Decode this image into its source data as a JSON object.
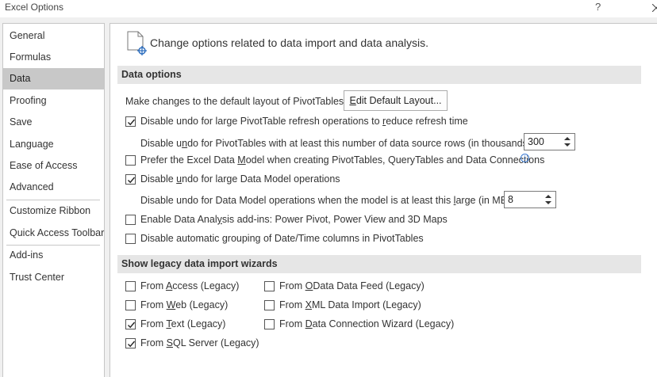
{
  "window": {
    "title": "Excel Options",
    "help_label": "?"
  },
  "sidebar": {
    "items": [
      {
        "label": "General"
      },
      {
        "label": "Formulas"
      },
      {
        "label": "Data"
      },
      {
        "label": "Proofing"
      },
      {
        "label": "Save"
      },
      {
        "label": "Language"
      },
      {
        "label": "Ease of Access"
      },
      {
        "label": "Advanced"
      },
      {
        "label": "Customize Ribbon"
      },
      {
        "label": "Quick Access Toolbar"
      },
      {
        "label": "Add-ins"
      },
      {
        "label": "Trust Center"
      }
    ],
    "selected": "Data"
  },
  "header": {
    "text": "Change options related to data import and data analysis."
  },
  "data_options": {
    "title": "Data options",
    "default_layout_label": "Make changes to the default layout of PivotTables:",
    "edit_layout_button": {
      "pre": "",
      "key": "E",
      "post": "dit Default Layout..."
    },
    "disable_undo_pivot": {
      "checked": true,
      "pre": "Disable undo for large PivotTable refresh operations to ",
      "key": "r",
      "post": "educe refresh time"
    },
    "undo_rows_label": {
      "pre": "Disable u",
      "key": "n",
      "post": "do for PivotTables with at least this number of data source rows (in thousands):"
    },
    "undo_rows_value": "300",
    "prefer_data_model": {
      "checked": false,
      "pre": "Prefer the Excel Data ",
      "key": "M",
      "post": "odel when creating PivotTables, QueryTables and Data Connections"
    },
    "disable_undo_model": {
      "checked": true,
      "pre": "Disable ",
      "key": "u",
      "post": "ndo for large Data Model operations"
    },
    "undo_model_label": {
      "pre": "Disable undo for Data Model operations when the model is at least this ",
      "key": "l",
      "post": "arge (in MB):"
    },
    "undo_model_value": "8",
    "enable_addins": {
      "checked": false,
      "pre": "Enable Data Anal",
      "key": "y",
      "post": "sis add-ins: Power Pivot, Power View and 3D Maps"
    },
    "disable_grouping": {
      "checked": false,
      "pre": "Disable automatic grouping of Date/Time columns in PivotTables",
      "key": "",
      "post": ""
    }
  },
  "legacy": {
    "title": "Show legacy data import wizards",
    "from_access": {
      "checked": false,
      "pre": "From ",
      "key": "A",
      "post": "ccess (Legacy)"
    },
    "from_web": {
      "checked": false,
      "pre": "From ",
      "key": "W",
      "post": "eb (Legacy)"
    },
    "from_text": {
      "checked": true,
      "pre": "From ",
      "key": "T",
      "post": "ext (Legacy)"
    },
    "from_sql": {
      "checked": true,
      "pre": "From ",
      "key": "S",
      "post": "QL Server (Legacy)"
    },
    "from_odata": {
      "checked": false,
      "pre": "From ",
      "key": "O",
      "post": "Data Data Feed (Legacy)"
    },
    "from_xml": {
      "checked": false,
      "pre": "From ",
      "key": "X",
      "post": "ML Data Import (Legacy)"
    },
    "from_dcw": {
      "checked": false,
      "pre": "From ",
      "key": "D",
      "post": "ata Connection Wizard (Legacy)"
    }
  }
}
